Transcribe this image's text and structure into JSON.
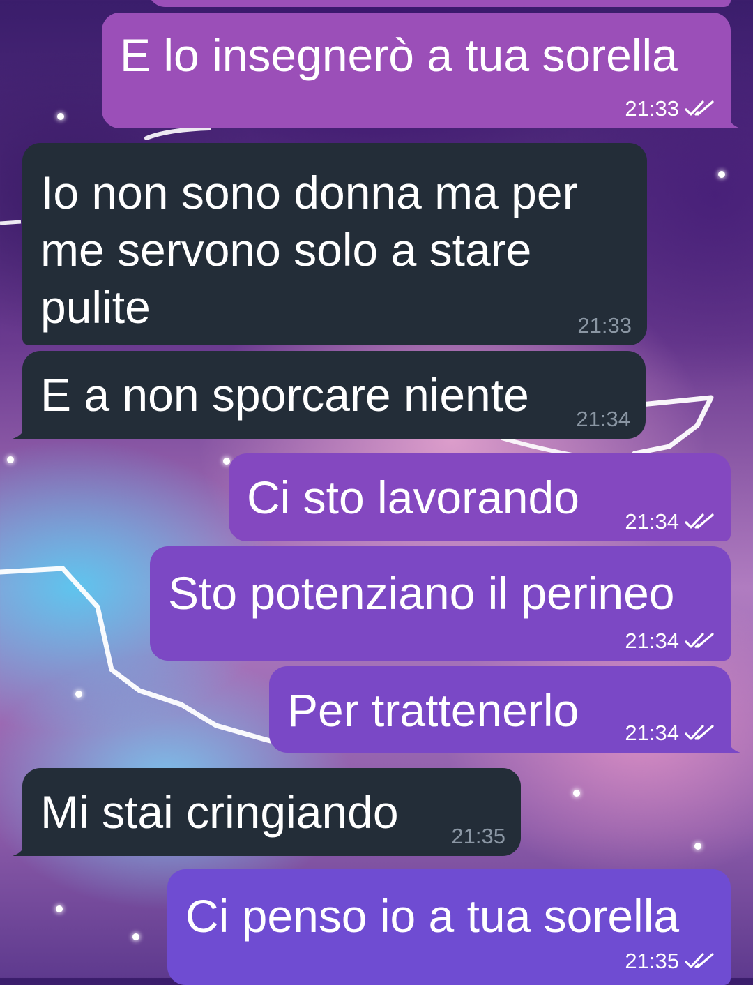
{
  "colors": {
    "outgoing_bubble_1": "#9b4fb8",
    "outgoing_bubble_2": "#8448c0",
    "outgoing_bubble_3": "#7a48c6",
    "outgoing_bubble_4": "#6f4cd2",
    "incoming_bubble": "#232d38",
    "incoming_time": "#8a96a3",
    "background_accent_blue": "#5ac8f0",
    "background_accent_pink": "#eaaad2"
  },
  "messages": [
    {
      "direction": "out",
      "text": "E lo insegnerò a tua sorella",
      "time": "21:33",
      "status_icon": "double-check-icon"
    },
    {
      "direction": "in",
      "text": "Io non sono donna ma per me servono solo a stare pulite",
      "time": "21:33"
    },
    {
      "direction": "in",
      "text": "E a non sporcare niente",
      "time": "21:34"
    },
    {
      "direction": "out",
      "text": "Ci sto lavorando",
      "time": "21:34",
      "status_icon": "double-check-icon"
    },
    {
      "direction": "out",
      "text": "Sto potenziano il perineo",
      "time": "21:34",
      "status_icon": "double-check-icon"
    },
    {
      "direction": "out",
      "text": "Per trattenerlo",
      "time": "21:34",
      "status_icon": "double-check-icon"
    },
    {
      "direction": "in",
      "text": "Mi stai cringiando",
      "time": "21:35"
    },
    {
      "direction": "out",
      "text": "Ci penso io a tua sorella",
      "time": "21:35",
      "status_icon": "double-check-icon"
    }
  ]
}
